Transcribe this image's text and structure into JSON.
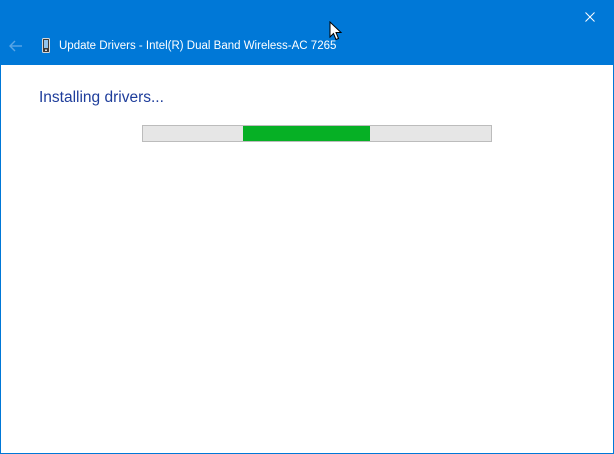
{
  "window": {
    "title": "Update Drivers - Intel(R) Dual Band Wireless-AC 7265",
    "accent_color": "#0078d7",
    "back_icon": "back-arrow-icon",
    "device_icon": "device-icon",
    "close_icon": "close-icon"
  },
  "content": {
    "status_text": "Installing drivers...",
    "status_color": "#1e3d9b"
  },
  "progress": {
    "mode": "indeterminate",
    "fill_color": "#06b025",
    "track_color": "#e6e6e6"
  }
}
